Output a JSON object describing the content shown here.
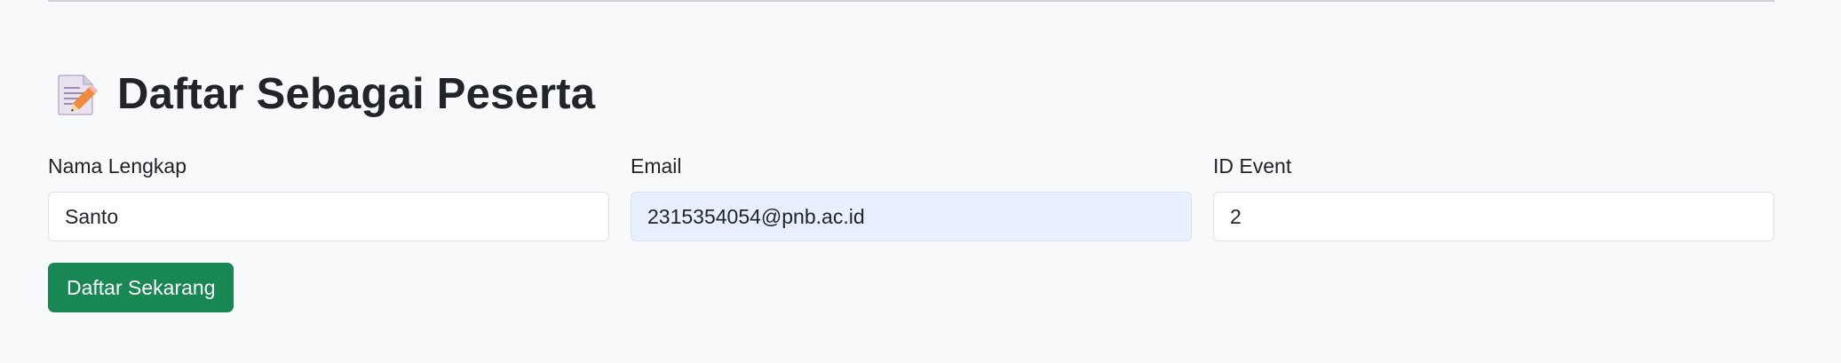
{
  "form": {
    "title": "Daftar Sebagai Peserta",
    "title_icon": "memo-emoji-icon",
    "fields": [
      {
        "label": "Nama Lengkap",
        "value": "Santo"
      },
      {
        "label": "Email",
        "value": "2315354054@pnb.ac.id"
      },
      {
        "label": "ID Event",
        "value": "2"
      }
    ],
    "submit_label": "Daftar Sekarang"
  },
  "colors": {
    "background": "#f8f9fa",
    "primary_button": "#198754",
    "autofill_field": "#e8f0fe",
    "text": "#212529"
  }
}
